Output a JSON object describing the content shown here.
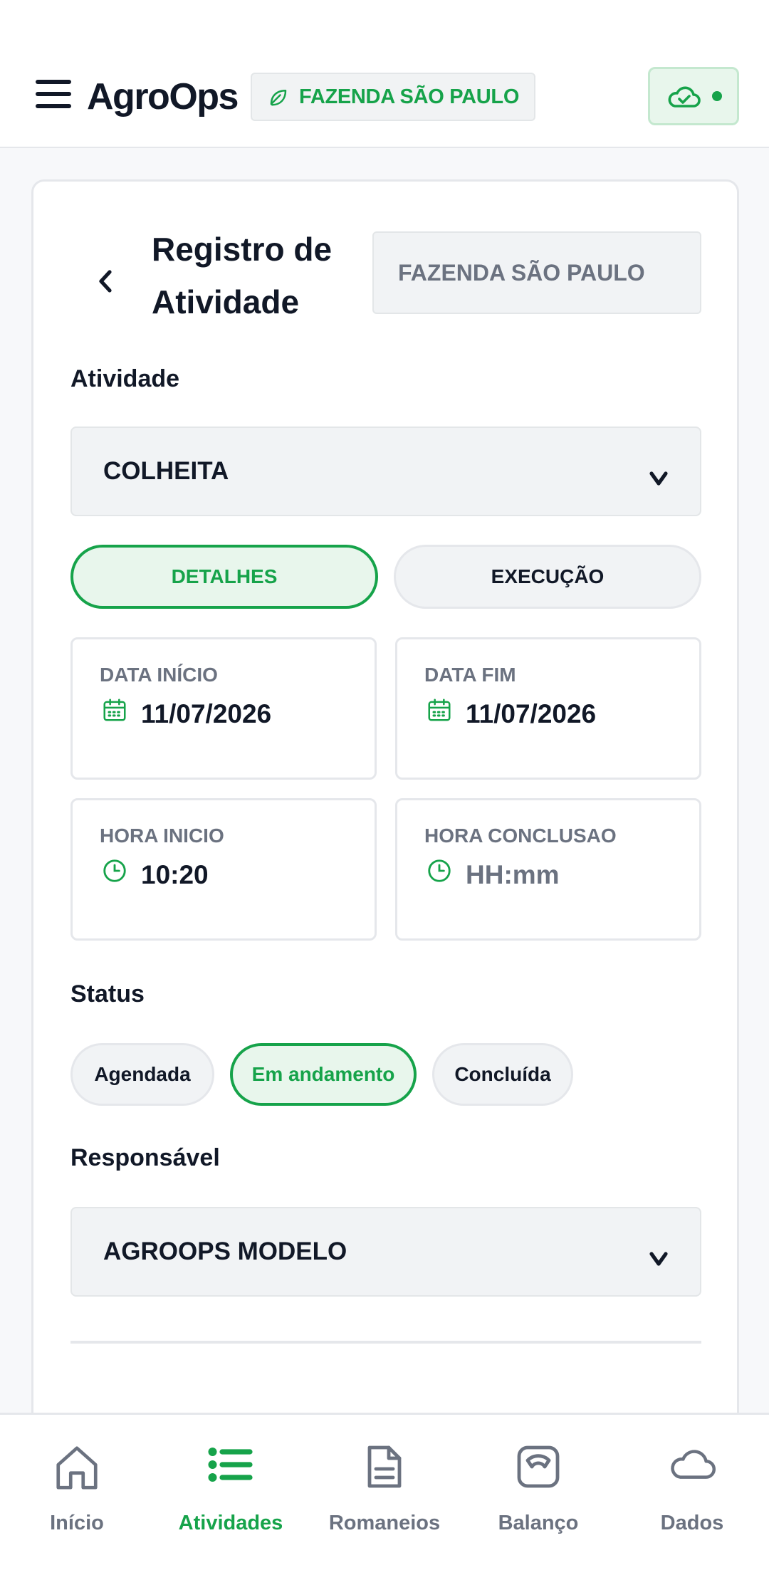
{
  "header": {
    "brand": "AgroOps",
    "farm_chip": "FAZENDA SÃO PAULO",
    "icons": {
      "menu": "hamburger-icon",
      "farm": "leaf-icon",
      "sync": "cloud-check-icon"
    }
  },
  "form": {
    "title": "Registro de Atividade",
    "farm_field": "FAZENDA SÃO PAULO",
    "activity_label": "Atividade",
    "activity_value": "COLHEITA",
    "tabs": [
      {
        "label": "DETALHES",
        "active": true
      },
      {
        "label": "EXECUÇÃO",
        "active": false
      }
    ],
    "fields": {
      "start_date": {
        "label": "DATA INÍCIO",
        "value": "11/07/2026"
      },
      "end_date": {
        "label": "DATA FIM",
        "value": "11/07/2026"
      },
      "start_time": {
        "label": "HORA INICIO",
        "value": "10:20"
      },
      "end_time": {
        "label": "HORA CONCLUSAO",
        "placeholder": "HH:mm"
      }
    },
    "status_label": "Status",
    "status_options": [
      {
        "label": "Agendada",
        "selected": false
      },
      {
        "label": "Em andamento",
        "selected": true
      },
      {
        "label": "Concluída",
        "selected": false
      }
    ],
    "responsible_label": "Responsável",
    "responsible_value": "AGROOPS MODELO"
  },
  "bottom_nav": [
    {
      "label": "Início",
      "icon": "home-icon",
      "active": false
    },
    {
      "label": "Atividades",
      "icon": "list-icon",
      "active": true
    },
    {
      "label": "Romaneios",
      "icon": "document-icon",
      "active": false
    },
    {
      "label": "Balanço",
      "icon": "scale-icon",
      "active": false
    },
    {
      "label": "Dados",
      "icon": "cloud-icon",
      "active": false
    }
  ],
  "colors": {
    "accent": "#16a34a",
    "accent_bg": "#e8f6ec",
    "text": "#111827",
    "muted": "#6b7280"
  }
}
